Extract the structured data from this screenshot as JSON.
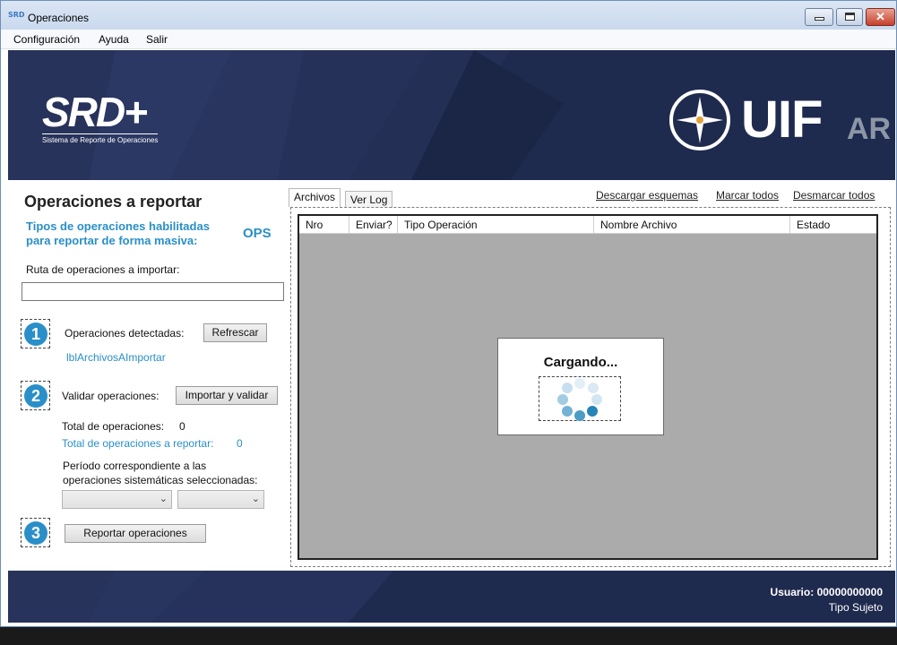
{
  "window": {
    "title": "Operaciones",
    "app_icon": "SRD"
  },
  "menu": {
    "items": [
      "Configuración",
      "Ayuda",
      "Salir"
    ]
  },
  "banner": {
    "srd_title": "SRD+",
    "srd_subtitle": "Sistema de Reporte de Operaciones",
    "uif_text": "UIF",
    "uif_ar": "AR"
  },
  "left": {
    "title": "Operaciones a reportar",
    "tipos_label": "Tipos de operaciones habilitadas para reportar de forma masiva:",
    "ops_value": "OPS",
    "ruta_label": "Ruta de operaciones a importar:",
    "ruta_value": "",
    "steps": [
      "1",
      "2",
      "3"
    ],
    "detectadas_label": "Operaciones detectadas:",
    "refrescar_button": "Refrescar",
    "archivos_label": "lblArchivosAImportar",
    "validar_label": "Validar operaciones:",
    "importar_button": "Importar y validar",
    "total_label": "Total de operaciones:",
    "total_value": "0",
    "total_reportar_label": "Total de operaciones a reportar:",
    "total_reportar_value": "0",
    "periodo_line1": "Período correspondiente a las",
    "periodo_line2": "operaciones sistemáticas seleccionadas:",
    "combo1_value": "",
    "combo2_value": "",
    "reportar_button": "Reportar operaciones"
  },
  "right": {
    "tabs": [
      "Archivos",
      "Ver Log"
    ],
    "links": [
      "Descargar esquemas",
      "Marcar todos",
      "Desmarcar todos"
    ],
    "columns": [
      "Nro",
      "Enviar?",
      "Tipo Operación",
      "Nombre Archivo",
      "Estado"
    ],
    "loading_text": "Cargando..."
  },
  "footer": {
    "usuario_label": "Usuario:",
    "usuario_value": "00000000000",
    "tipo_sujeto": "Tipo Sujeto"
  },
  "colors": {
    "accent_blue": "#2a8fc8",
    "banner_navy": "#1f2a4f",
    "grid_gray": "#ababab"
  }
}
